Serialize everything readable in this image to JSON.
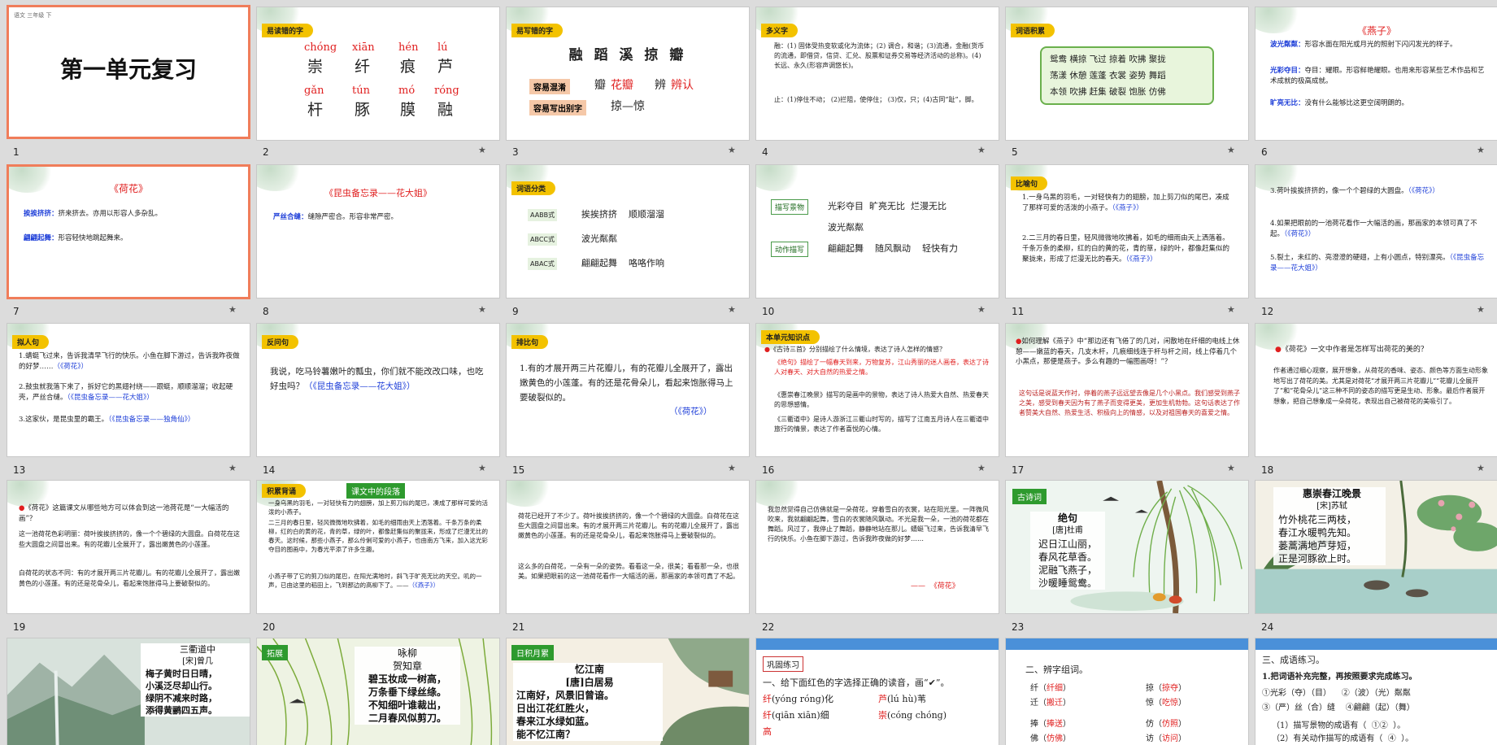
{
  "slides": [
    {
      "num": "1",
      "title": "第一单元复习",
      "header_tiny": "语文  三年级  下"
    },
    {
      "num": "2",
      "badge": "易读错的字",
      "items": [
        [
          "chóng",
          "崇"
        ],
        [
          "xiān",
          "纤"
        ],
        [
          "hén",
          "痕"
        ],
        [
          "lú",
          "芦"
        ],
        [
          "gǎn",
          "杆"
        ],
        [
          "tún",
          "豚"
        ],
        [
          "mó",
          "膜"
        ],
        [
          "róng",
          "融"
        ]
      ]
    },
    {
      "num": "3",
      "badge": "易写错的字",
      "chars": "融 蹈 溪 掠 瓣",
      "row1_label": "容易混淆",
      "row1_a": "瓣",
      "row1_b": "花瓣",
      "row1_c": "辨",
      "row1_d": "辨认",
      "row2_label": "容易写出别字",
      "row2_text": "掠—惊"
    },
    {
      "num": "4",
      "badge": "多义字",
      "line1": "融：(1) 固体受热变软或化为流体；(2) 调合，和谐；(3)流通，金融(货币的流通，即借贷，信贷、汇兑、股票和证券交易等经济活动的总称)。(4)长远、永久(形容声调悠长)。",
      "line2": "止：(1)停住不动；  (2)拦阻，使停住； (3)仅，只；(4)古同“趾”，脚。"
    },
    {
      "num": "5",
      "badge": "词语积累",
      "lines": [
        "鸳鸯  横掠  飞过  掠着  吹拂  聚拢",
        "荡漾  休憩  莲蓬  衣裳  姿势  舞蹈",
        "本领  吹拂  赶集  破裂  饱胀  仿佛"
      ]
    },
    {
      "num": "6",
      "title": "《燕子》",
      "t1": "波光粼粼：",
      "d1": "形容水面在阳光或月光的照射下闪闪发光的样子。",
      "t2": "光彩夺目：",
      "d2": "夺目：耀眼。形容鲜艳耀眼。也用来形容某些艺术作品和艺术成就的极高成就。",
      "t3": "旷亮无比：",
      "d3": "没有什么能够比这更空阔明朗的。"
    },
    {
      "num": "7",
      "title": "《荷花》",
      "t1": "挨挨挤挤：",
      "d1": "挤来挤去。亦用以形容人多杂乱。",
      "t2": "翩翩起舞：",
      "d2": "形容轻快地跳起舞来。"
    },
    {
      "num": "8",
      "title": "《昆虫备忘录——花大姐》",
      "t1": "严丝合缝：",
      "d1": "缝隙严密合。形容非常严密。"
    },
    {
      "num": "9",
      "badge": "词语分类",
      "rows": [
        [
          "AABB式",
          "挨挨挤挤    顺顺溜溜"
        ],
        [
          "ABCC式",
          "波光粼粼"
        ],
        [
          "ABAC式",
          "翩翩起舞    咯咯作响"
        ]
      ]
    },
    {
      "num": "10",
      "tag1": "描写景物",
      "w1a": "光彩夺目  旷亮无比  烂漫无比",
      "w1b": "波光粼粼",
      "tag2": "动作描写",
      "w2": "翩翩起舞    随风飘动    轻快有力"
    },
    {
      "num": "11",
      "badge": "比喻句",
      "p1": "1.一身乌黑的羽毛，一对轻快有力的翅膀，加上剪刀似的尾巴，凑成了那样可爱的活泼的小燕子。",
      "s1": "（《燕子》）",
      "p2": "2.二三月的春日里，轻风微微地吹拂着，如毛的细雨由天上洒落着。千条万条的柔柳，红的白的黄的花，青的草，绿的叶，都像赶集似的聚拢来，形成了烂漫无比的春天。",
      "s2": "（《燕子》）"
    },
    {
      "num": "12",
      "p3": "3.荷叶挨挨挤挤的，像一个个碧绿的大圆盘。",
      "s3": "（《荷花》）",
      "p4": "4.如果把眼前的一池荷花看作一大幅活的画，那画家的本领可真了不起。",
      "s4": "（《荷花》）",
      "p5": "5.裂土，未红的、亮澄澄的硬翅，上有小圆点，特别漂亮。",
      "s5": "（《昆虫备忘录——花大姐》）"
    },
    {
      "num": "13",
      "badge": "拟人句",
      "p1": "1.蜻蜓飞过来，告诉我清早飞行的快乐。小鱼在脚下游过，告诉我昨夜做的好梦……",
      "s1": "（《荷花》）",
      "p2": "2.鼓虫就我落下来了，拆好它的黑翅衬绕——跟蜓，顺顺溜溜；收起硬壳，严丝合缝。",
      "s2": "（《昆虫备忘录——花大姐》）",
      "p3": "3.这家伙，是昆虫里的霸王。",
      "s3": "（《昆虫备忘录——独角仙》）"
    },
    {
      "num": "14",
      "badge": "反问句",
      "p1": "我说，吃马铃薯嫩叶的瓢虫，你们就不能改改口味，也吃好虫吗？",
      "s1": "（《昆虫备忘录——花大姐》）"
    },
    {
      "num": "15",
      "badge": "排比句",
      "p1": "1.有的才展开两三片花瓣儿，有的花瓣儿全展开了，露出嫩黄色的小莲蓬。有的还是花骨朵儿，看起来饱胀得马上要破裂似的。",
      "s1": "（《荷花》）"
    },
    {
      "num": "16",
      "badge": "本单元知识点",
      "q": "《古诗三首》分别描绘了什么情境，表达了诗人怎样的情感？",
      "a1": "《绝句》描绘了一幅春天到来，万物复苏，江山秀丽的迷人画卷，表达了诗人对春天、对大自然的热爱之情。",
      "a2": "《惠崇春江晚景》描写的是画中的景物，表达了诗人热爱大自然、热爱春天的思想感情。",
      "a3": "《三衢道中》是诗人游浙江三衢山时写的，描写了江南五月诗人在三衢道中旅行的情景，表达了作者喜悦的心情。"
    },
    {
      "num": "17",
      "q": "如何理解《燕子》中“那边还有飞倦了的几对，闲散地在纤细的电线上休憩——嫩蓝的春天，几支木杆，几痕细线连于杆与杆之间，线上停着几个小黑点，那便是燕子。多么有趣的一幅图画呀！”？",
      "a": "这句话是说蓝天作衬，停着的燕子远远望去像是几个小黑点。我们感受到燕子之美，感受到春天因为有了燕子而变得更美，更加生机勃勃。这句话表达了作者赞美大自然、热爱生活、积极向上的情感，以及对祖国春天的喜爱之情。"
    },
    {
      "num": "18",
      "q": "《荷花》一文中作者是怎样写出荷花的美的？",
      "a": "作者通过细心观察，展开想象，从荷花的香味、姿态、颜色等方面生动形象地写出了荷花的美。尤其是对荷花“才展开两三片花瓣儿”“花瓣儿全展开了”和“花骨朵儿”这三种不同的姿态的描写更是生动、形象。最后作者展开想象，把自己想象成一朵荷花，表现出自己被荷花的美吸引了。"
    },
    {
      "num": "19",
      "q": "《荷花》这篇课文从哪些地方可以体会到这一池荷花是“一大幅活的画”？",
      "a1": "这一池荷花色彩明丽：荷叶挨挨挤挤的，像一个个碧绿的大圆盘。白荷花在这些大圆盘之间冒出来。有的花瓣儿全展开了，露出嫩黄色的小莲蓬。",
      "a2": "白荷花的状态不同：有的才展开两三片花瓣儿。有的花瓣儿全展开了，露出嫩黄色的小莲蓬。有的还是花骨朵儿，看起来饱胀得马上要破裂似的。"
    },
    {
      "num": "20",
      "badge": "积累背诵",
      "label": "课文中的段落",
      "p1": "一身乌黑的羽毛，一对轻快有力的翅膀，加上剪刀似的尾巴，凑成了那样可爱的活泼的小燕子。",
      "p2": "二三月的春日里，轻风微微地吹拂着，如毛的细雨由天上洒落着。千条万条的柔柳，红的白的黄的花，青的草，绿的叶，都像赶集似的聚拢来，形成了烂漫无比的春天。这时候，那些小燕子，那么伶俐可爱的小燕子，也由南方飞来，加入这光彩夺目的图画中，为春光平添了许多生趣。",
      "p3": "小燕子带了它的剪刀似的尾巴，在阳光满地时，斜飞于旷亮无比的天空。叽的一声，已由这里的稻田上，飞到那边的高柳下了。——",
      "s3": "（《燕子》）"
    },
    {
      "num": "21",
      "p1": "荷花已经开了不少了。荷叶挨挨挤挤的，像一个个碧绿的大圆盘。白荷花在这些大圆盘之间冒出来。有的才展开两三片花瓣儿。有的花瓣儿全展开了，露出嫩黄色的小莲蓬。有的还是花骨朵儿，看起来饱胀得马上要破裂似的。",
      "p2": "这么多的白荷花，一朵有一朵的姿势。看看这一朵，很美；看看那一朵，也很美。如果把眼前的这一池荷花看作一大幅活的画，那画家的本领可真了不起。"
    },
    {
      "num": "22",
      "p1": "我忽然觉得自己仿佛就是一朵荷花，穿着雪白的衣裳，站在阳光里。一阵微风吹来，我就翩翩起舞，雪白的衣裳随风飘动。不光是我一朵，一池的荷花都在舞蹈。风过了，我停止了舞蹈，静静地站在那儿。蜻蜓飞过来，告诉我清早飞行的快乐。小鱼在脚下游过，告诉我昨夜做的好梦……",
      "s1": "——  《荷花》"
    },
    {
      "num": "23",
      "label": "古诗词",
      "title": "绝句",
      "author": "[唐]杜甫",
      "lines": [
        "迟日江山丽，",
        "春风花草香。",
        "泥融飞燕子，",
        "沙暖睡鸳鸯。"
      ]
    },
    {
      "num": "24",
      "title": "惠崇春江晚景",
      "author": "[宋]苏轼",
      "lines": [
        "竹外桃花三两枝，",
        "春江水暖鸭先知。",
        "蒌蒿满地芦芽短，",
        "正是河豚欲上时。"
      ]
    },
    {
      "num": "19b",
      "title": "三衢道中",
      "author": "[宋]曾几",
      "lines": [
        "梅子黄时日日晴，",
        "小溪泛尽却山行。",
        "绿阴不减来时路，",
        "添得黄鹂四五声。"
      ]
    },
    {
      "num": "20b",
      "label": "拓展",
      "title": "咏柳",
      "author": "贺知章",
      "lines": [
        "碧玉妆成一树高，",
        "万条垂下绿丝绦。",
        "不知细叶谁裁出，",
        "二月春风似剪刀。"
      ]
    },
    {
      "num": "21b",
      "label": "日积月累",
      "title": "忆江南",
      "author": "[唐]白居易",
      "lines": [
        "江南好，风景旧曾谙。",
        "日出江花红胜火，",
        "春来江水绿如蓝。",
        "能不忆江南？"
      ]
    },
    {
      "num": "22b",
      "label": "巩固练习",
      "q": "一、给下面红色的字选择正确的读音，画“✔”。",
      "l1a": "纤",
      "l1b": "(yóng róng)化",
      "l1c": "芦",
      "l1d": "(lú hù)苇",
      "l2a": "纤",
      "l2b": "(qiān xiān)细",
      "l2c": "崇",
      "l2d": "(cóng chóng)",
      "l3": "高"
    },
    {
      "num": "23b",
      "q": "二、辨字组词。",
      "rows": [
        [
          "纤（",
          "纤细",
          "）",
          "掠（",
          "掠夺",
          "）"
        ],
        [
          "迁（",
          "搬迁",
          "）",
          "惊（",
          "吃惊",
          "）"
        ],
        [
          "捧（",
          "捧送",
          "）",
          "仿（",
          "仿照",
          "）"
        ],
        [
          "佛（",
          "仿佛",
          "）",
          "访（",
          "访问",
          "）"
        ]
      ]
    },
    {
      "num": "24b",
      "q": "三、成语练习。",
      "q1": "1.把词语补充完整，再按照要求完成练习。",
      "r1": "①光彩（夺）（目）    ②（波）（光）粼粼",
      "r2": "③（严）丝（合）缝    ④翩翩（起）（舞）",
      "r3": "（1）描写景物的成语有（  ①②  ）。",
      "r4": "（2）有关动作描写的成语有（  ④  ）。"
    }
  ],
  "slide_numbers": [
    "1",
    "2",
    "3",
    "4",
    "5",
    "6",
    "7",
    "8",
    "9",
    "10",
    "11",
    "12",
    "13",
    "14",
    "15",
    "16",
    "17",
    "18",
    "19",
    "20",
    "21",
    "22",
    "23",
    "24"
  ],
  "star_icon": "★"
}
